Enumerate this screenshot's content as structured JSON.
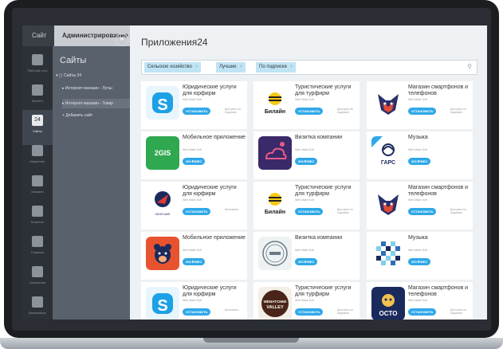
{
  "topbar": {
    "tab_site": "Сайт",
    "tab_admin": "Администрирование"
  },
  "nav": [
    {
      "label": "Рабочий стол"
    },
    {
      "label": "Контент"
    },
    {
      "label": "Сайты",
      "active": true,
      "badge": "24"
    },
    {
      "label": "Маркетинг"
    },
    {
      "label": "Магазин"
    },
    {
      "label": "Клиенты"
    },
    {
      "label": "Сервисы"
    },
    {
      "label": "Аналитика"
    },
    {
      "label": "Marketplace"
    }
  ],
  "sidepanel": {
    "title": "Сайты",
    "tree": [
      {
        "label": "Сайты 24"
      },
      {
        "label": "Интернет-магазин - Лучш"
      },
      {
        "label": "Интернет-магазин - Товар"
      },
      {
        "label": "Добавить сайт"
      }
    ]
  },
  "store": {
    "title": "Приложения24",
    "filters": [
      "Сельское хозяйство",
      "Лучшие",
      "По подписке"
    ],
    "close": "×",
    "apps": [
      {
        "name": "Юридические услуги для юрфирм",
        "vendor": "Web Make Soft",
        "button": "УСТАНОВИТЬ",
        "note": "Доступно по подписке",
        "logo": "skype"
      },
      {
        "name": "Туристические услуги для турфирм",
        "vendor": "Web Make Soft",
        "button": "УСТАНОВИТЬ",
        "note": "Доступно по подписке",
        "logo": "beeline"
      },
      {
        "name": "Магазин смартфонов и телефонов",
        "vendor": "Web Make Soft",
        "button": "УСТАНОВИТЬ",
        "note": "Доступно по подписке",
        "logo": "fox"
      },
      {
        "name": "Мобильное приложение",
        "vendor": "Web Make Soft",
        "button": "300 ₽/МЕС",
        "note": "",
        "logo": "2gis"
      },
      {
        "name": "Визитка компании",
        "vendor": "Web Make Soft",
        "button": "300 ₽/МЕС",
        "note": "",
        "logo": "cloud"
      },
      {
        "name": "Музыка",
        "vendor": "Web Make Soft",
        "button": "300 ₽/МЕС",
        "note": "",
        "logo": "garc"
      },
      {
        "name": "Юридические услуги для юрфирм",
        "vendor": "Web Make Soft",
        "button": "УСТАНОВИТЬ",
        "note": "Бесплатно",
        "logo": "sunflame"
      },
      {
        "name": "Туристические услуги для турфирм",
        "vendor": "Web Make Soft",
        "button": "УСТАНОВИТЬ",
        "note": "Доступно по подписке",
        "logo": "beeline"
      },
      {
        "name": "Магазин смартфонов и телефонов",
        "vendor": "Web Make Soft",
        "button": "УСТАНОВИТЬ",
        "note": "Доступно по подписке",
        "logo": "fox"
      },
      {
        "name": "Мобильное приложение",
        "vendor": "Web Make Soft",
        "button": "300 ₽/МЕС",
        "note": "",
        "logo": "bear"
      },
      {
        "name": "Визитка компании",
        "vendor": "Web Make Soft",
        "button": "300 ₽/МЕС",
        "note": "",
        "logo": "stamp"
      },
      {
        "name": "Музыка",
        "vendor": "Web Make Soft",
        "button": "300 ₽/МЕС",
        "note": "",
        "logo": "pixels"
      },
      {
        "name": "Юридические услуги для юрфирм",
        "vendor": "Web Make Soft",
        "button": "УСТАНОВИТЬ",
        "note": "Бесплатно",
        "logo": "skype"
      },
      {
        "name": "Туристические услуги для турфирм",
        "vendor": "Web Make Soft",
        "button": "УСТАНОВИТЬ",
        "note": "Доступно по подписке",
        "logo": "valley"
      },
      {
        "name": "Магазин смартфонов и телефонов",
        "vendor": "Web Make Soft",
        "button": "УСТАНОВИТЬ",
        "note": "Доступно по подписке",
        "logo": "octo"
      }
    ]
  },
  "logos": {
    "beeline": "Билайн",
    "2gis": "2GIS",
    "garc": "ГАРС",
    "sunflame": "SUNFLAME",
    "octo": "OCTO",
    "valley": "WENATCHEE VALLEY"
  },
  "colors": {
    "accent": "#2fa8e8",
    "chip": "#bfe4f5",
    "skype": "#1da1e6",
    "gis": "#2fa84f",
    "cloud": "#3a2a6a"
  }
}
